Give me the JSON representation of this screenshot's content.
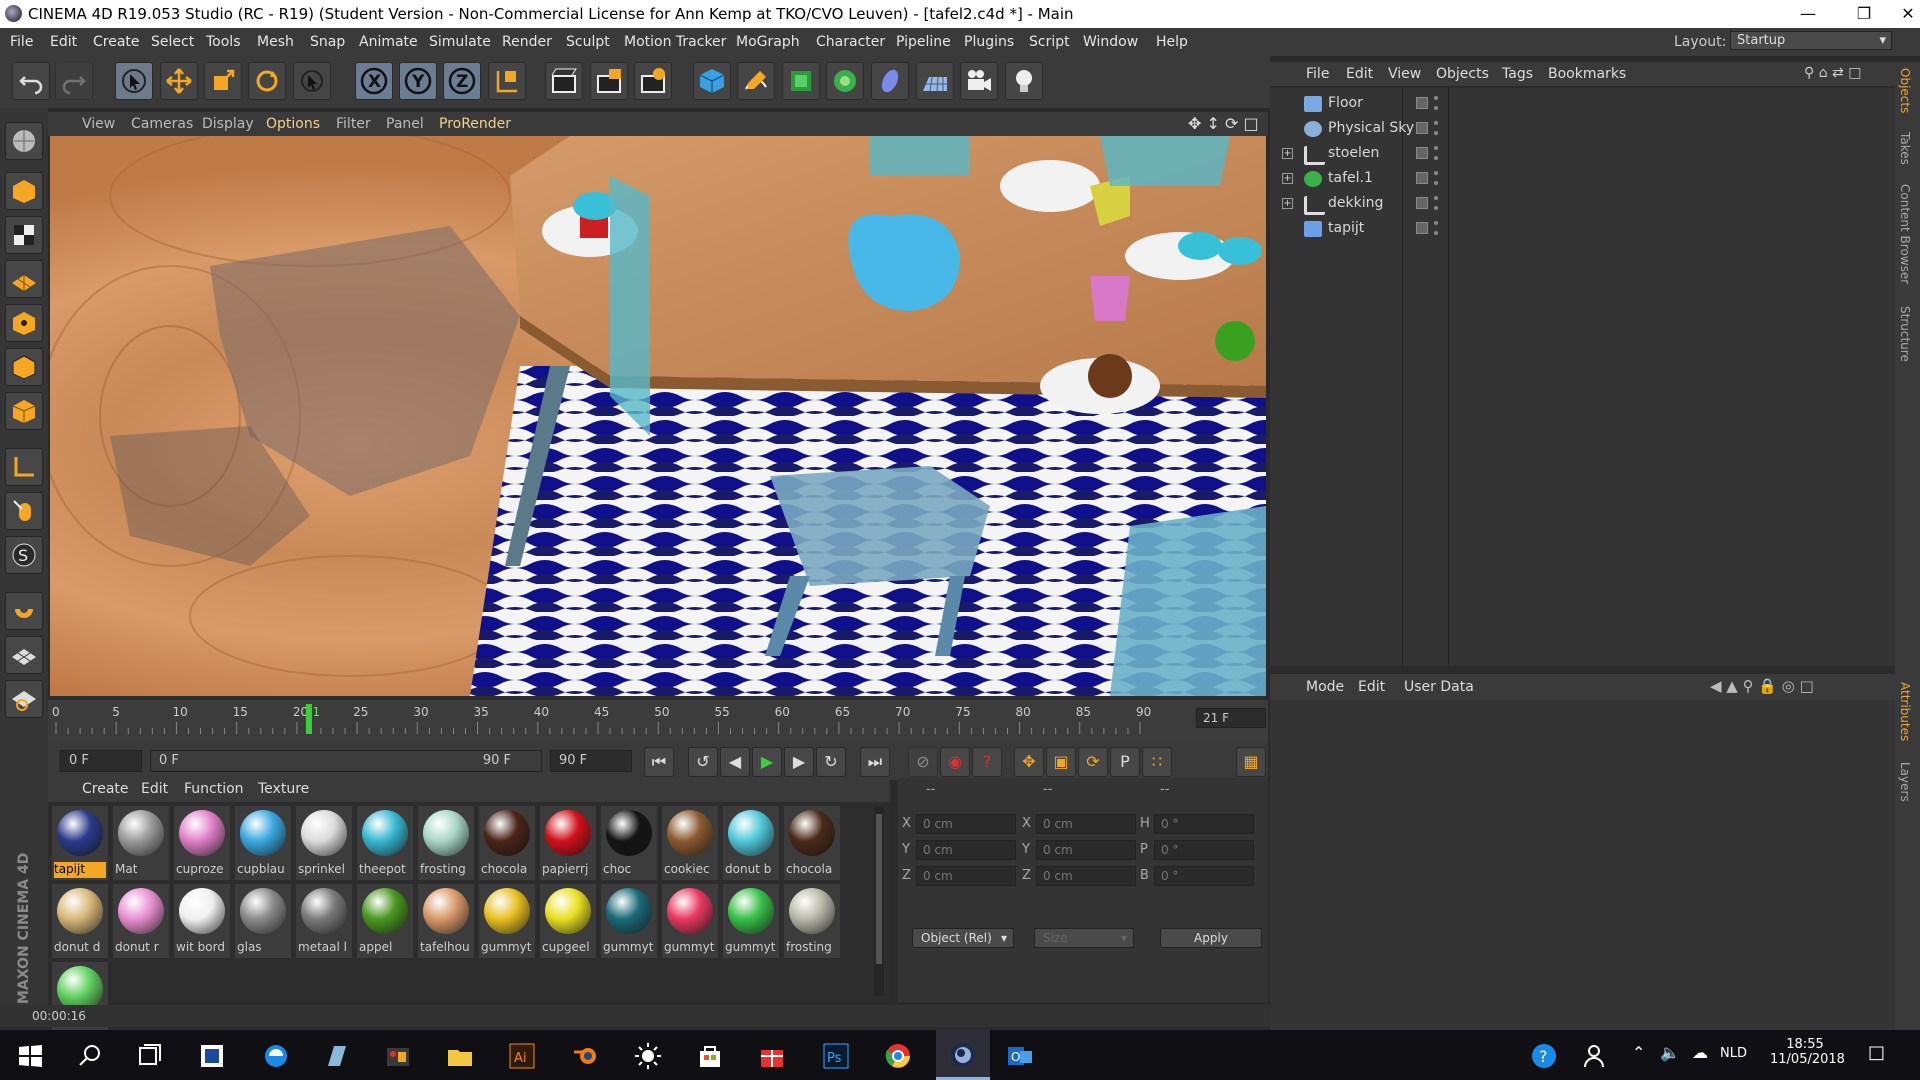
{
  "window": {
    "title": "CINEMA 4D R19.053 Studio (RC - R19) (Student Version - Non-Commercial License for Ann Kemp at TKO/CVO Leuven) - [tafel2.c4d *] - Main"
  },
  "menu": {
    "items": [
      "File",
      "Edit",
      "Create",
      "Select",
      "Tools",
      "Mesh",
      "Snap",
      "Animate",
      "Simulate",
      "Render",
      "Sculpt",
      "Motion Tracker",
      "MoGraph",
      "Character",
      "Pipeline",
      "Plugins",
      "Script",
      "Window",
      "Help"
    ],
    "layout_label": "Layout:",
    "layout_value": "Startup"
  },
  "toolbar": {
    "icons": [
      "undo-icon",
      "redo-icon",
      "live-selection-icon",
      "move-icon",
      "scale-icon",
      "rotate-icon",
      "recent-tool-icon",
      "x-axis-icon",
      "y-axis-icon",
      "z-axis-icon",
      "world-coordinates-icon",
      "render-view-icon",
      "render-picture-viewer-icon",
      "edit-render-settings-icon",
      "cube-icon",
      "pen-icon",
      "subdivision-icon",
      "cloner-icon",
      "deformer-icon",
      "floor-icon",
      "camera-icon",
      "light-icon"
    ]
  },
  "viewport_menu": [
    "View",
    "Cameras",
    "Display",
    "Options",
    "Filter",
    "Panel",
    "ProRender"
  ],
  "timeline": {
    "ticks": [
      "0",
      "5",
      "10",
      "15",
      "20",
      "21",
      "25",
      "30",
      "35",
      "40",
      "45",
      "50",
      "55",
      "60",
      "65",
      "70",
      "75",
      "80",
      "85",
      "90"
    ],
    "current_frame": "21 F",
    "current_frame_value": 21,
    "max_frame": 90
  },
  "playback": {
    "start": "0 F",
    "range_start": "0 F",
    "range_end": "90 F",
    "end": "90 F"
  },
  "materials": {
    "menu": [
      "Create",
      "Edit",
      "Function",
      "Texture"
    ],
    "row1": [
      {
        "label": "tapijt",
        "color": "#2a3b8a",
        "selected": true
      },
      {
        "label": "Mat",
        "color": "#9a9a9a"
      },
      {
        "label": "cuproze",
        "color": "#e080c8"
      },
      {
        "label": "cupblau",
        "color": "#3aa8e0"
      },
      {
        "label": "sprinkel",
        "color": "#dcdcdc"
      },
      {
        "label": "theepot",
        "color": "#38b8d0"
      },
      {
        "label": "frosting",
        "color": "#a8d8c8"
      },
      {
        "label": "chocola",
        "color": "#4a2418"
      },
      {
        "label": "papierrj",
        "color": "#d0101a"
      },
      {
        "label": "choc",
        "color": "#151515"
      },
      {
        "label": "cookiec",
        "color": "#8a5a30"
      },
      {
        "label": "donut b",
        "color": "#50c8d8"
      },
      {
        "label": "chocola",
        "color": "#4a2a18"
      }
    ],
    "row2": [
      {
        "label": "donut d",
        "color": "#d8b878"
      },
      {
        "label": "donut r",
        "color": "#e890d0"
      },
      {
        "label": "wit bord",
        "color": "#f0f0f0"
      },
      {
        "label": "glas",
        "color": "#8a8a8a"
      },
      {
        "label": "metaal l",
        "color": "#7a7a7a"
      },
      {
        "label": "appel",
        "color": "#4a9820"
      },
      {
        "label": "tafelhou",
        "color": "#d89868"
      },
      {
        "label": "gummyt",
        "color": "#e8c020"
      },
      {
        "label": "cupgeel",
        "color": "#e8e020"
      },
      {
        "label": "gummyt",
        "color": "#1a6a78"
      },
      {
        "label": "gummyt",
        "color": "#e83860"
      },
      {
        "label": "gummyt",
        "color": "#38c048"
      },
      {
        "label": "frosting",
        "color": "#b8b8a8"
      }
    ],
    "row3": [
      {
        "label": "",
        "color": "#60d060"
      }
    ]
  },
  "coordinates": {
    "labels_pos": [
      "X",
      "Y",
      "Z"
    ],
    "pos": [
      "0 cm",
      "0 cm",
      "0 cm"
    ],
    "labels_size": [
      "X",
      "Y",
      "Z"
    ],
    "size": [
      "0 cm",
      "0 cm",
      "0 cm"
    ],
    "labels_rot": [
      "H",
      "P",
      "B"
    ],
    "rot": [
      "0 °",
      "0 °",
      "0 °"
    ],
    "dash1": "--",
    "dash2": "--",
    "dash3": "--",
    "mode": "Object (Rel)",
    "size_mode": "Size",
    "apply": "Apply"
  },
  "status": {
    "time": "00:00:16"
  },
  "objects": {
    "menu": [
      "File",
      "Edit",
      "View",
      "Objects",
      "Tags",
      "Bookmarks"
    ],
    "items": [
      {
        "name": "Floor",
        "icon": "floor-icon",
        "expander": ""
      },
      {
        "name": "Physical Sky",
        "icon": "sky-icon",
        "expander": ""
      },
      {
        "name": "stoelen",
        "icon": "null-icon",
        "expander": "+"
      },
      {
        "name": "tafel.1",
        "icon": "cloner-icon",
        "expander": "+"
      },
      {
        "name": "dekking",
        "icon": "null-icon",
        "expander": "+"
      },
      {
        "name": "tapijt",
        "icon": "plane-icon",
        "expander": ""
      }
    ]
  },
  "attributes": {
    "menu": [
      "Mode",
      "Edit",
      "User Data"
    ]
  },
  "right_tabs": [
    "Objects",
    "Takes",
    "Content Browser",
    "Structure",
    "Attributes",
    "Layers"
  ],
  "brand": "MAXON CINEMA 4D",
  "taskbar": {
    "lang": "NLD",
    "time": "18:55",
    "date": "11/05/2018"
  },
  "colors": {
    "accent": "#f5a623",
    "panel": "#343434",
    "titlebar": "#ffffff",
    "taskbar": "#101014"
  }
}
